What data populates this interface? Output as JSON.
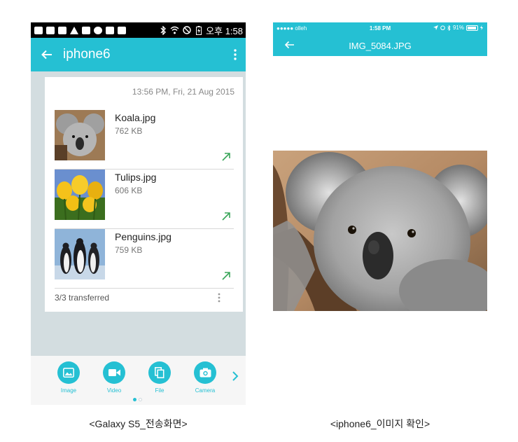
{
  "android": {
    "status_time": "오후 1:58",
    "toolbar_title": "iphone6",
    "card": {
      "date": "13:56 PM, Fri, 21 Aug 2015",
      "items": [
        {
          "name": "Koala.jpg",
          "size": "762 KB"
        },
        {
          "name": "Tulips.jpg",
          "size": "606 KB"
        },
        {
          "name": "Penguins.jpg",
          "size": "759 KB"
        }
      ],
      "transferred": "3/3 transferred"
    },
    "tools": [
      {
        "label": "Image"
      },
      {
        "label": "Video"
      },
      {
        "label": "File"
      },
      {
        "label": "Camera"
      }
    ]
  },
  "ios": {
    "carrier": "●●●●● olleh",
    "time": "1:58 PM",
    "battery": "91%",
    "title": "IMG_5084.JPG"
  },
  "captions": {
    "left": "<Galaxy S5_전송화면>",
    "right": "<iphone6_이미지 확인>"
  },
  "colors": {
    "accent": "#25c0d3",
    "arrow": "#3aa65a"
  }
}
